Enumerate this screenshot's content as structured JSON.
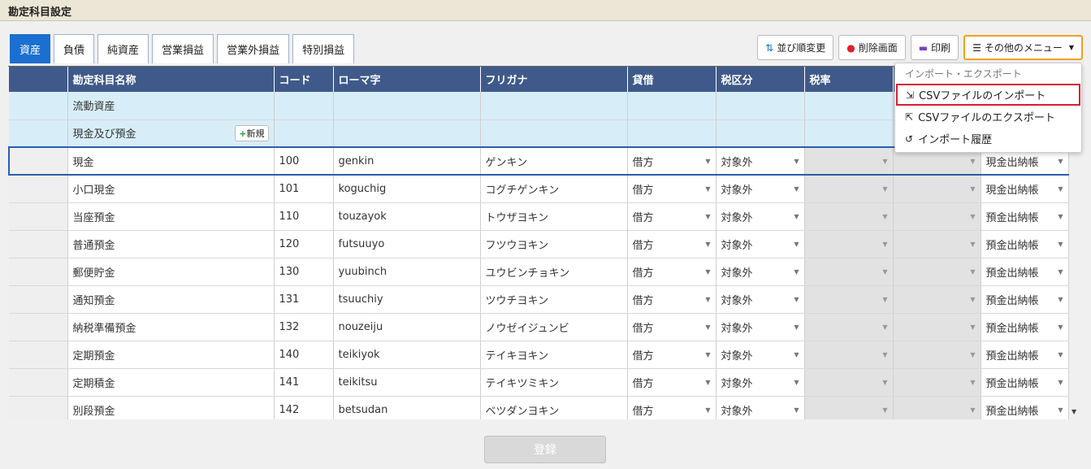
{
  "page_title": "勘定科目設定",
  "tabs": [
    {
      "label": "資産",
      "active": true
    },
    {
      "label": "負債"
    },
    {
      "label": "純資産"
    },
    {
      "label": "営業損益"
    },
    {
      "label": "営業外損益"
    },
    {
      "label": "特別損益"
    }
  ],
  "toolbar": {
    "sort_label": "並び順変更",
    "delete_label": "削除画面",
    "print_label": "印刷",
    "other_menu_label": "その他のメニュー"
  },
  "columns": [
    "勘定科目名称",
    "コード",
    "ローマ字",
    "フリガナ",
    "貸借",
    "税区分",
    "税率",
    "",
    ""
  ],
  "groups": [
    {
      "label": "流動資産"
    },
    {
      "label": "現金及び預金",
      "new_label": "新規"
    }
  ],
  "rows": [
    {
      "name": "現金",
      "code": "100",
      "romaji": "genkin",
      "furigana": "ゲンキン",
      "taishaku": "借方",
      "zeikubun": "対象外",
      "book": "現金出納帳"
    },
    {
      "name": "小口現金",
      "code": "101",
      "romaji": "koguchig",
      "furigana": "コグチゲンキン",
      "taishaku": "借方",
      "zeikubun": "対象外",
      "book": "現金出納帳"
    },
    {
      "name": "当座預金",
      "code": "110",
      "romaji": "touzayok",
      "furigana": "トウザヨキン",
      "taishaku": "借方",
      "zeikubun": "対象外",
      "book": "預金出納帳"
    },
    {
      "name": "普通預金",
      "code": "120",
      "romaji": "futsuuyo",
      "furigana": "フツウヨキン",
      "taishaku": "借方",
      "zeikubun": "対象外",
      "book": "預金出納帳"
    },
    {
      "name": "郵便貯金",
      "code": "130",
      "romaji": "yuubinch",
      "furigana": "ユウビンチョキン",
      "taishaku": "借方",
      "zeikubun": "対象外",
      "book": "預金出納帳"
    },
    {
      "name": "通知預金",
      "code": "131",
      "romaji": "tsuuchiy",
      "furigana": "ツウチヨキン",
      "taishaku": "借方",
      "zeikubun": "対象外",
      "book": "預金出納帳"
    },
    {
      "name": "納税準備預金",
      "code": "132",
      "romaji": "nouzeiju",
      "furigana": "ノウゼイジュンビ",
      "taishaku": "借方",
      "zeikubun": "対象外",
      "book": "預金出納帳"
    },
    {
      "name": "定期預金",
      "code": "140",
      "romaji": "teikiyok",
      "furigana": "テイキヨキン",
      "taishaku": "借方",
      "zeikubun": "対象外",
      "book": "預金出納帳"
    },
    {
      "name": "定期積金",
      "code": "141",
      "romaji": "teikitsu",
      "furigana": "テイキツミキン",
      "taishaku": "借方",
      "zeikubun": "対象外",
      "book": "預金出納帳"
    },
    {
      "name": "別段預金",
      "code": "142",
      "romaji": "betsudan",
      "furigana": "ベツダンヨキン",
      "taishaku": "借方",
      "zeikubun": "対象外",
      "book": "預金出納帳"
    }
  ],
  "dropdown": {
    "header": "インポート・エクスポート",
    "items": [
      "CSVファイルのインポート",
      "CSVファイルのエクスポート",
      "インポート履歴"
    ]
  },
  "register_label": "登録"
}
